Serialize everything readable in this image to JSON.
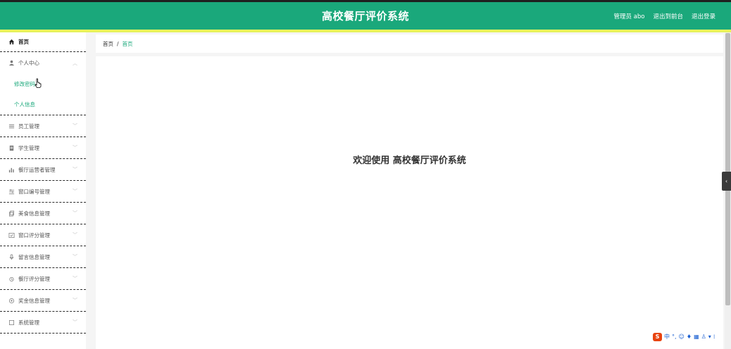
{
  "header": {
    "title": "高校餐厅评价系统",
    "user_label": "管理员 abo",
    "to_frontend": "退出到前台",
    "logout": "退出登录"
  },
  "sidebar": {
    "home": "首页",
    "personal_center": "个人中心",
    "sub_items": [
      "修改密码",
      "个人信息"
    ],
    "items": [
      {
        "label": "员工管理",
        "icon": "list-icon"
      },
      {
        "label": "学生管理",
        "icon": "bookmark-icon"
      },
      {
        "label": "餐厅运营者管理",
        "icon": "bar-chart-icon"
      },
      {
        "label": "窗口编号管理",
        "icon": "sliders-icon"
      },
      {
        "label": "美食信息管理",
        "icon": "copy-icon"
      },
      {
        "label": "窗口评分管理",
        "icon": "checkbox-icon"
      },
      {
        "label": "留言信息管理",
        "icon": "microphone-icon"
      },
      {
        "label": "餐厅评分管理",
        "icon": "alarm-icon"
      },
      {
        "label": "奖金信息管理",
        "icon": "settings-icon"
      },
      {
        "label": "系统管理",
        "icon": "square-icon"
      }
    ]
  },
  "breadcrumb": {
    "root": "首页",
    "separator": "/",
    "current": "首页"
  },
  "main": {
    "welcome": "欢迎使用 高校餐厅评价系统"
  },
  "colors": {
    "brand": "#1aa87b",
    "accent": "#e8f25b",
    "header_dark": "#1f1f1f"
  }
}
